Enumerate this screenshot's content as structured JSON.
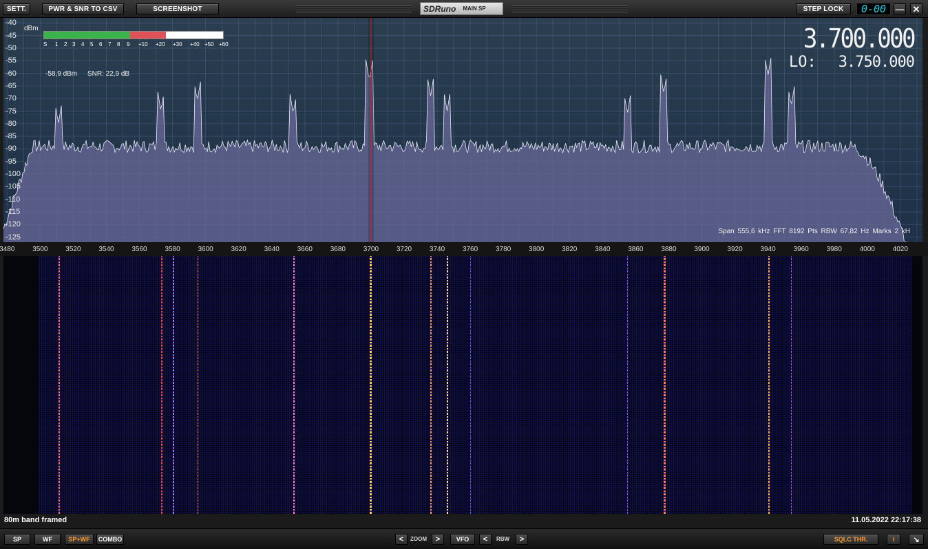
{
  "toolbar": {
    "sett": "SETT.",
    "pwr_snr": "PWR & SNR TO CSV",
    "screenshot": "SCREENSHOT",
    "app_name": "SDRuno",
    "panel_name": "MAIN SP",
    "step_lock": "STEP LOCK",
    "time_display": "0-00",
    "minimize": "—",
    "close": "✕"
  },
  "spectrum": {
    "unit": "dBm",
    "db_ticks": [
      "-40",
      "-45",
      "-50",
      "-55",
      "-60",
      "-65",
      "-70",
      "-75",
      "-80",
      "-85",
      "-90",
      "-95",
      "-100",
      "-105",
      "-110",
      "-115",
      "-120",
      "-125"
    ],
    "smeter_labels": [
      "S",
      "1",
      "2",
      "3",
      "4",
      "5",
      "6",
      "7",
      "8",
      "9",
      "+10",
      "+20",
      "+30",
      "+40",
      "+50",
      "+60"
    ],
    "smeter_level_fraction": 0.68,
    "power": "-58,9 dBm",
    "snr": "SNR: 22,9 dB",
    "frequency": "3.700.000",
    "lo_label": "LO:",
    "lo_frequency": "3.750.000",
    "span": "Span 555,6 kHz",
    "fft": "FFT 8192 Pts",
    "rbw": "RBW 67,82 Hz",
    "marks": "Marks 2 kH"
  },
  "xaxis": {
    "labels": [
      "3480",
      "3500",
      "3520",
      "3540",
      "3560",
      "3580",
      "3600",
      "3620",
      "3640",
      "3660",
      "3680",
      "3700",
      "3720",
      "3740",
      "3760",
      "3780",
      "3800",
      "3820",
      "3840",
      "3860",
      "3880",
      "3900",
      "3920",
      "3940",
      "3960",
      "3980",
      "4000",
      "4020"
    ]
  },
  "chart_data": {
    "type": "line",
    "xlabel": "",
    "ylabel": "dBm",
    "xlim": [
      3477.8,
      4033.4
    ],
    "ylim": [
      -127,
      -38
    ],
    "noise_floor": -89,
    "peaks": [
      {
        "x": 3511,
        "y": -80
      },
      {
        "x": 3573,
        "y": -75
      },
      {
        "x": 3595,
        "y": -71
      },
      {
        "x": 3653,
        "y": -76
      },
      {
        "x": 3699,
        "y": -63
      },
      {
        "x": 3736,
        "y": -69
      },
      {
        "x": 3746,
        "y": -75
      },
      {
        "x": 3855,
        "y": -76
      },
      {
        "x": 3877,
        "y": -68
      },
      {
        "x": 3940,
        "y": -61
      },
      {
        "x": 3954,
        "y": -73
      }
    ],
    "series": [
      {
        "values": []
      }
    ],
    "colors": {
      "fill": "#6a6a9a",
      "line": "#ececf5",
      "marker": "#e02020"
    }
  },
  "waterfall": {
    "caption": "80m band framed",
    "timestamp": "11.05.2022 22:17:38"
  },
  "bottombar": {
    "sp": "SP",
    "wf": "WF",
    "spwf": "SP+WF",
    "combo": "COMBO",
    "zoom_label": "ZOOM",
    "zoom_left": "<",
    "zoom_right": ">",
    "vfo": "VFO",
    "rbw_label": "RBW",
    "rbw_left": "<",
    "rbw_right": ">",
    "sqlc": "SQLC THR.",
    "info": "i",
    "resize": "↘"
  }
}
